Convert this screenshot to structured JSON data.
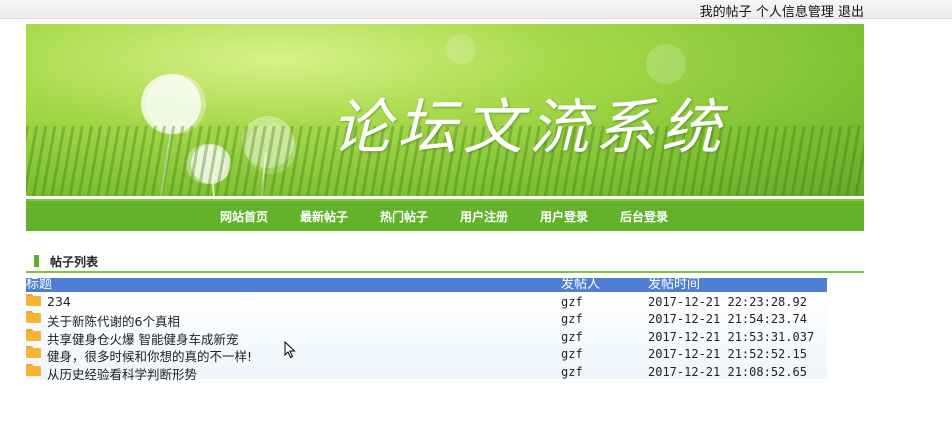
{
  "topnav": {
    "links": [
      "我的帖子",
      "个人信息管理",
      "退出"
    ]
  },
  "banner": {
    "title": "论坛文流系统"
  },
  "navbar": {
    "items": [
      "网站首页",
      "最新帖子",
      "热门帖子",
      "用户注册",
      "用户登录",
      "后台登录"
    ]
  },
  "section": {
    "title": "帖子列表"
  },
  "table": {
    "columns": [
      "标题",
      "发帖人",
      "发帖时间"
    ],
    "rows": [
      {
        "title": "234",
        "author": "gzf",
        "time": "2017-12-21 22:23:28.92"
      },
      {
        "title": "关于新陈代谢的6个真相",
        "author": "gzf",
        "time": "2017-12-21 21:54:23.74"
      },
      {
        "title": "共享健身仓火爆 智能健身车成新宠",
        "author": "gzf",
        "time": "2017-12-21 21:53:31.037"
      },
      {
        "title": "健身，很多时候和你想的真的不一样!",
        "author": "gzf",
        "time": "2017-12-21 21:52:52.15"
      },
      {
        "title": "从历史经验看科学判断形势",
        "author": "gzf",
        "time": "2017-12-21 21:08:52.65"
      }
    ]
  },
  "colors": {
    "nav_green": "#62b22a",
    "header_blue": "#4f7fd3",
    "folder_orange": "#f7b538"
  },
  "icons": {
    "row_icon": "folder-icon",
    "cursor": "mouse-pointer-icon"
  }
}
